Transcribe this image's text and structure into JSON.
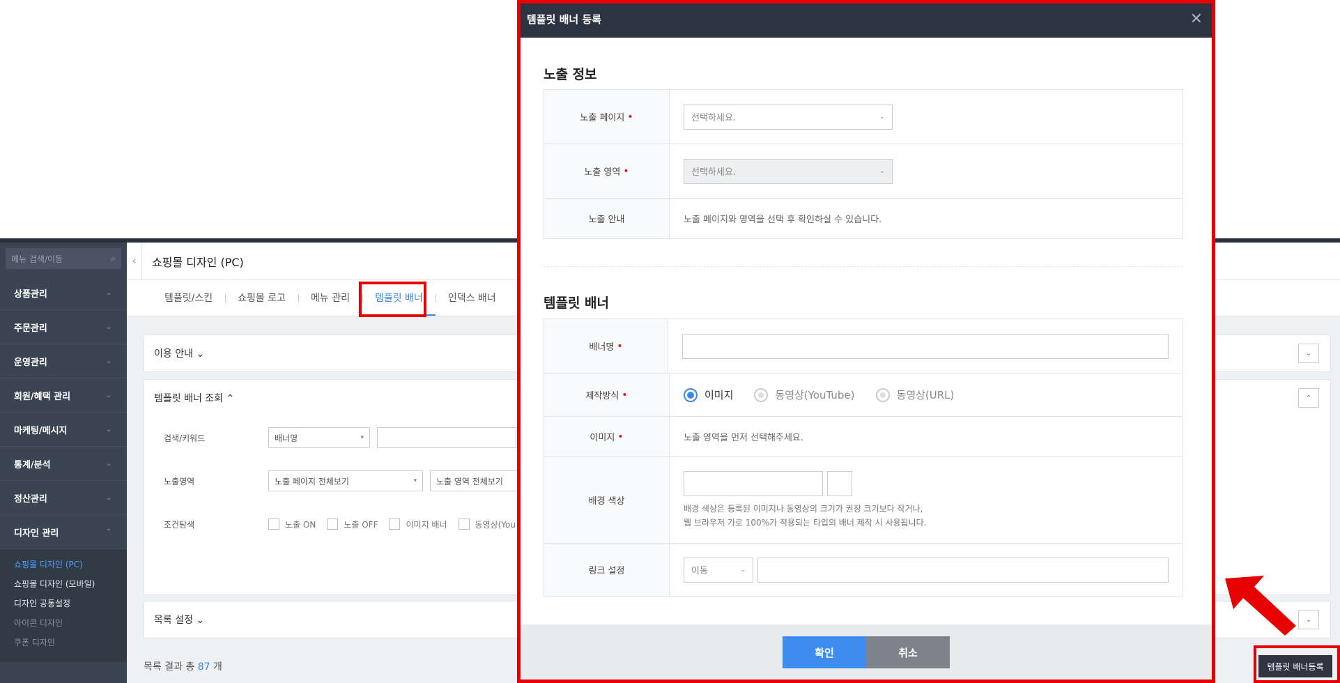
{
  "sidebar": {
    "search_placeholder": "메뉴 검색/이동",
    "items": [
      {
        "label": "상품관리"
      },
      {
        "label": "주문관리"
      },
      {
        "label": "운영관리"
      },
      {
        "label": "회원/혜택 관리"
      },
      {
        "label": "마케팅/메시지"
      },
      {
        "label": "통계/분석"
      },
      {
        "label": "정산관리"
      },
      {
        "label": "디자인 관리"
      }
    ],
    "sub_items": [
      {
        "label": "쇼핑몰 디자인 (PC)"
      },
      {
        "label": "쇼핑몰 디자인 (모바일)"
      },
      {
        "label": "디자인 공통설정"
      },
      {
        "label": "아이콘 디자인"
      },
      {
        "label": "쿠폰 디자인"
      }
    ]
  },
  "header": {
    "collapse": "‹",
    "title": "쇼핑몰 디자인 (PC)"
  },
  "tabs": [
    {
      "label": "템플릿/스킨"
    },
    {
      "label": "쇼핑몰 로고"
    },
    {
      "label": "메뉴 관리"
    },
    {
      "label": "템플릿 배너"
    },
    {
      "label": "인덱스 배너"
    }
  ],
  "panels": {
    "guide": "이용 안내 ⌄",
    "search": "템플릿 배너 조회 ⌃",
    "list": "목록 설정 ⌄"
  },
  "filters": {
    "keyword_label": "검색/키워드",
    "keyword_select": "배너명",
    "area_label": "노출영역",
    "page_all": "노출 페이지 전체보기",
    "area_all": "노출 영역 전체보기",
    "cond_label": "조건탐색",
    "checks": [
      "노출 ON",
      "노출 OFF",
      "이미지 배너",
      "동영상(You"
    ]
  },
  "result": {
    "prefix": "목록 결과 총",
    "count": "87",
    "suffix": "개"
  },
  "register_button": "템플릿 배너등록",
  "modal": {
    "title": "템플릿 배너 등록",
    "close": "✕",
    "section1": "노출 정보",
    "page_label": "노출 페이지",
    "page_placeholder": "선택하세요.",
    "area_label": "노출 영역",
    "area_placeholder": "선택하세요.",
    "guide_label": "노출 안내",
    "guide_text": "노출 페이지와 영역을 선택 후 확인하실 수 있습니다.",
    "section2": "템플릿 배너",
    "name_label": "배너명",
    "method_label": "제작방식",
    "methods": [
      "이미지",
      "동영상(YouTube)",
      "동영상(URL)"
    ],
    "image_label": "이미지",
    "image_text": "노출 영역을 먼저 선택해주세요.",
    "bg_label": "배경 색상",
    "bg_note1": "배경 색상은 등록된 이미지나 동영상의 크기가 권장 크기보다 작거나,",
    "bg_note2": "웹 브라우저 가로 100%가 적용되는 타입의 배너 제작 시 사용됩니다.",
    "link_label": "링크 설정",
    "link_select": "이동",
    "ok": "확인",
    "cancel": "취소"
  },
  "colors": {
    "accent": "#3a87e8",
    "highlight": "#e60000",
    "header": "#2d3441"
  }
}
